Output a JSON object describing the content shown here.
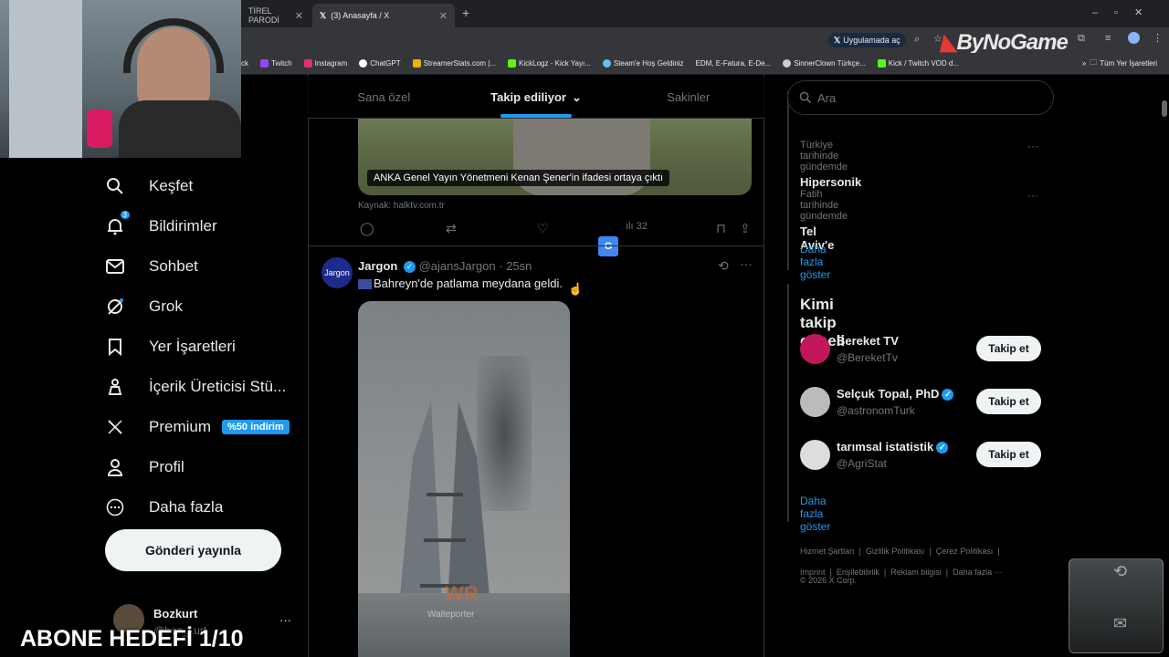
{
  "browser": {
    "tabs": [
      {
        "label": "TİREL PARODİ"
      },
      {
        "label": "(3) Anasayfa / X"
      }
    ],
    "new_tab": "+",
    "translate_pill": "Uygulamada aç",
    "bookmarks": [
      {
        "label": "ck",
        "color": "#777"
      },
      {
        "label": "Twitch",
        "color": "#9146ff"
      },
      {
        "label": "Instagram",
        "color": "#e1306c"
      },
      {
        "label": "ChatGPT",
        "color": "#ffffff"
      },
      {
        "label": "StreamerStats.com |...",
        "color": "#e8b400"
      },
      {
        "label": "KickLogz - Kick Yayı...",
        "color": "#53fc18"
      },
      {
        "label": "Steam'e Hoş Geldiniz",
        "color": "#66c0f4"
      },
      {
        "label": "EDM, E-Fatura, E-De...",
        "color": "#999999"
      },
      {
        "label": "SinnerClown Türkçe...",
        "color": "#cccccc"
      },
      {
        "label": "Kick / Twitch VOD d...",
        "color": "#53fc18"
      }
    ],
    "all_bookmarks": "Tüm Yer İşaretleri"
  },
  "watermark": "ByNoGame",
  "overlay_text": "ABONE HEDEFİ 1/10",
  "nav": {
    "items": [
      {
        "label": "Keşfet",
        "icon": "search-icon"
      },
      {
        "label": "Bildirimler",
        "icon": "bell-icon",
        "badge": "3"
      },
      {
        "label": "Sohbet",
        "icon": "mail-icon"
      },
      {
        "label": "Grok",
        "icon": "grok-icon"
      },
      {
        "label": "Yer İşaretleri",
        "icon": "bookmark-icon"
      },
      {
        "label": "İçerik Üreticisi Stü...",
        "icon": "creator-icon"
      },
      {
        "label": "Premium",
        "icon": "x-logo-icon",
        "badge": "%50 indirim"
      },
      {
        "label": "Profil",
        "icon": "person-icon"
      },
      {
        "label": "Daha fazla",
        "icon": "more-circle-icon"
      }
    ],
    "post_button": "Gönderi yayınla",
    "account": {
      "name": "Bozkurt",
      "handle": "@boz_kurt",
      "more": "···"
    }
  },
  "feed": {
    "tabs": [
      {
        "label": "Sana özel"
      },
      {
        "label": "Takip ediliyor"
      },
      {
        "label": "Sakinler"
      }
    ],
    "tweet1": {
      "caption": "ANKA Genel Yayın Yönetmeni Kenan Şener'in ifadesi ortaya çıktı",
      "source": "Kaynak: halktv.com.tr",
      "views": "32"
    },
    "tweet2": {
      "avatar_text": "Jargon",
      "name": "Jargon",
      "handle": "@ajansJargon",
      "time": "· 25sn",
      "text": "Bahreyn'de patlama meydana geldi.",
      "image_watermark": "WR",
      "image_credit": "Walteporter"
    }
  },
  "right": {
    "search_placeholder": "Ara",
    "trends": [
      {
        "meta": "Türkiye tarihinde gündemde",
        "name": "Hipersonik"
      },
      {
        "meta": "Fatih tarihinde gündemde",
        "name": "Tel Aviv'e"
      }
    ],
    "show_more": "Daha fazla göster",
    "who_to_follow_title": "Kimi takip etmeli",
    "suggestions": [
      {
        "name": "Bereket TV",
        "handle": "@BereketTv",
        "verified": false,
        "color": "#c2185b"
      },
      {
        "name": "Selçuk Topal, PhD",
        "handle": "@astronomTurk",
        "verified": true,
        "color": "#bbbbbb"
      },
      {
        "name": "tarımsal istatistik",
        "handle": "@AgriStat",
        "verified": true,
        "color": "#dddddd"
      }
    ],
    "follow_label": "Takip et",
    "footer": [
      "Hizmet Şartları",
      "Gizlilik Politikası",
      "Çerez Politikası",
      "Imprint",
      "Erişilebilirlik",
      "Reklam bilgisi",
      "Daha fazla ···"
    ],
    "copyright": "© 2026 X Corp."
  }
}
